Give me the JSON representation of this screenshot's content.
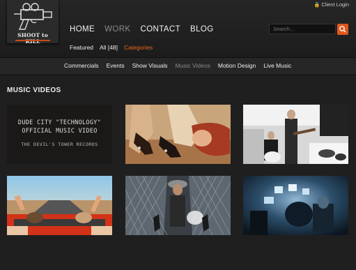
{
  "header": {
    "logo_text": "SHOOT to KILL",
    "client_login": "Client Login",
    "search_placeholder": "Search..."
  },
  "main_nav": [
    "HOME",
    "WORK",
    "CONTACT",
    "BLOG"
  ],
  "filters": {
    "featured": "Featured",
    "all": "All [48]",
    "categories": "Categories"
  },
  "categories": [
    "Commercials",
    "Events",
    "Show Visuals",
    "Music Videos",
    "Motion Design",
    "Live Music"
  ],
  "section_title": "MUSIC VIDEOS",
  "videos": {
    "first": {
      "line1": "DUDE CITY \"TECHNOLOGY\"",
      "line2": "OFFICIAL MUSIC VIDEO",
      "line3": "THE DEVIL'S TOWER RECORDS"
    }
  },
  "colors": {
    "accent": "#e0561c",
    "background": "#1f1f1f"
  }
}
